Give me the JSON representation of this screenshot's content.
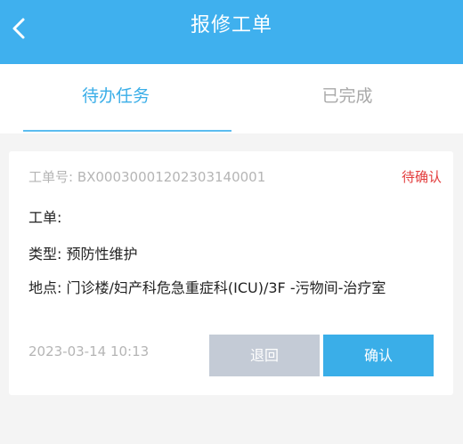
{
  "header": {
    "title": "报修工单",
    "back_icon": "chevron-left-icon"
  },
  "tabs": [
    {
      "label": "待办任务",
      "active": true
    },
    {
      "label": "已完成",
      "active": false
    }
  ],
  "colors": {
    "header_bg": "#3fb0ee",
    "active_tab": "#3aaee8",
    "status_red": "#e23c3c",
    "return_button": "#c4cbd6",
    "confirm_button": "#3aaee8"
  },
  "work_order": {
    "number_text": "工单号: BX000300012023031400​01",
    "status": "待确认",
    "order_line": "工单:",
    "type_line": "类型: 预防性维护",
    "location_line": "地点: 门诊楼/妇产科危急重症科(ICU)/3F -污物间-治疗室",
    "datetime": "2023-03-14 10:13",
    "return_label": "退回",
    "confirm_label": "确认"
  }
}
